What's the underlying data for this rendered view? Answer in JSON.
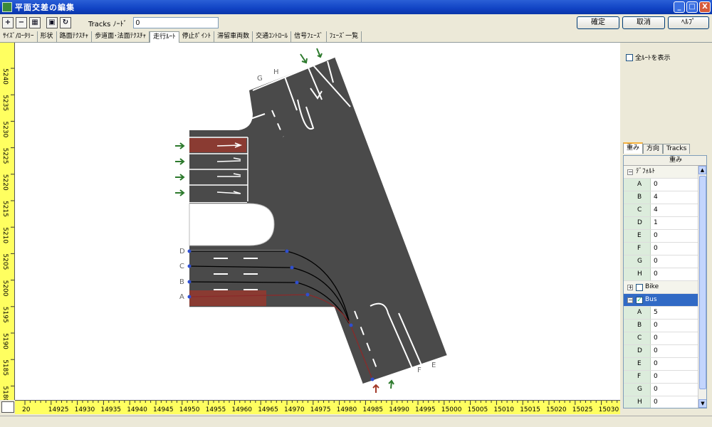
{
  "window": {
    "title": "平面交差の編集",
    "minimize": "_",
    "maximize": "□",
    "close": "X"
  },
  "toolbar": {
    "tracks_label": "Tracks ﾉｰﾄﾞ",
    "tracks_value": "0",
    "confirm": "確定",
    "cancel": "取消",
    "help": "ﾍﾙﾌﾟ"
  },
  "tabs": [
    "ｻｲｽﾞ/ﾛｰﾀﾘｰ",
    "形状",
    "路面ﾃｸｽﾁｬ",
    "歩道面･法面ﾃｸｽﾁｬ",
    "走行ﾙｰﾄ",
    "停止ﾎﾟｲﾝﾄ",
    "滞留車両数",
    "交通ｺﾝﾄﾛｰﾙ",
    "信号ﾌｪｰｽﾞ",
    "ﾌｪｰｽﾞ一覧"
  ],
  "active_tab": 4,
  "right_panel": {
    "show_all_routes": "全ﾙｰﾄを表示",
    "tabs": [
      "重み",
      "方向",
      "Tracks"
    ],
    "grid_header": "重み",
    "groups": [
      {
        "name": "ﾃﾞﾌｫﾙﾄ",
        "rows": [
          {
            "k": "A",
            "v": "0"
          },
          {
            "k": "B",
            "v": "4"
          },
          {
            "k": "C",
            "v": "4"
          },
          {
            "k": "D",
            "v": "1"
          },
          {
            "k": "E",
            "v": "0"
          },
          {
            "k": "F",
            "v": "0"
          },
          {
            "k": "G",
            "v": "0"
          },
          {
            "k": "H",
            "v": "0"
          }
        ]
      },
      {
        "name": "Bike"
      },
      {
        "name": "Bus",
        "rows": [
          {
            "k": "A",
            "v": "5"
          },
          {
            "k": "B",
            "v": "0"
          },
          {
            "k": "C",
            "v": "0"
          },
          {
            "k": "D",
            "v": "0"
          },
          {
            "k": "E",
            "v": "0"
          },
          {
            "k": "F",
            "v": "0"
          },
          {
            "k": "G",
            "v": "0"
          },
          {
            "k": "H",
            "v": "0"
          }
        ]
      }
    ]
  },
  "rulers": {
    "x_ticks": [
      "20",
      "14925",
      "14930",
      "14935",
      "14940",
      "14945",
      "14950",
      "14955",
      "14960",
      "14965",
      "14970",
      "14975",
      "14980",
      "14985",
      "14990",
      "14995",
      "15000",
      "15005",
      "15010",
      "15015",
      "15020",
      "15025",
      "15030"
    ],
    "y_ticks": [
      "5240",
      "5235",
      "5230",
      "5225",
      "5220",
      "5215",
      "5210",
      "5205",
      "5200",
      "5195",
      "5190",
      "5185",
      "5180"
    ]
  },
  "lane_labels": {
    "west": [
      "D",
      "C",
      "B",
      "A"
    ],
    "north": [
      "G",
      "H"
    ],
    "south": [
      "F",
      "E"
    ]
  },
  "colors": {
    "road": "#4a4a4a",
    "bus_lane": "#8a3b32",
    "route": "#000000",
    "route_node": "#2f4fd0",
    "arrow": "#2d7a2d",
    "arrow_active": "#a33a2a",
    "ruler": "#ffff60"
  }
}
